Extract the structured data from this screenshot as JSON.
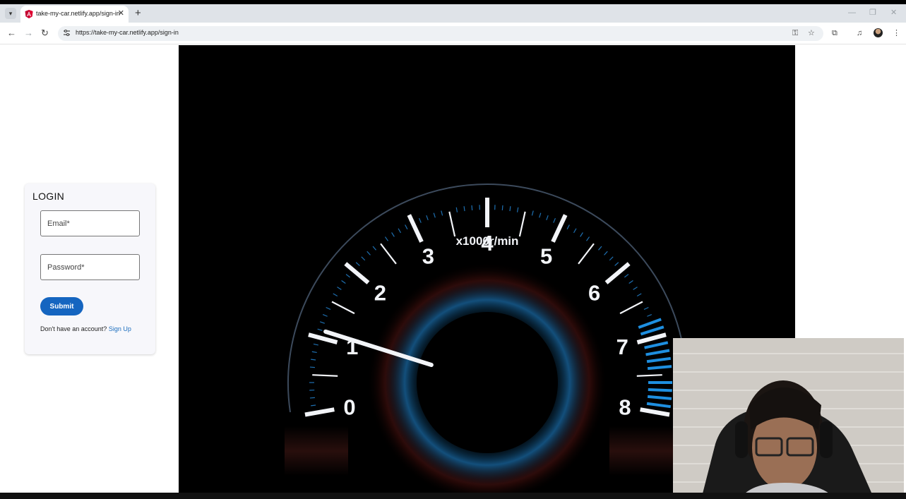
{
  "browser": {
    "tab": {
      "title": "take-my-car.netlify.app/sign-in",
      "close_label": "✕"
    },
    "new_tab_label": "+",
    "url": "https://take-my-car.netlify.app/sign-in",
    "window_controls": {
      "minimize": "—",
      "restore": "❐",
      "close": "✕"
    }
  },
  "login": {
    "title": "LOGIN",
    "email_placeholder": "Email*",
    "password_placeholder": "Password*",
    "submit_label": "Submit",
    "signup_prompt": "Don't have an account?",
    "signup_link": "Sign Up"
  },
  "hero": {
    "gauge_numbers": [
      "0",
      "1",
      "2",
      "3",
      "4",
      "5",
      "6",
      "7",
      "8"
    ],
    "gauge_unit": "x1000r/min",
    "needle_value": 1.1
  },
  "icons": {
    "tab_list": "chevron-down-icon",
    "favicon": "angular-logo-icon",
    "back": "arrow-left-icon",
    "forward": "arrow-right-icon",
    "reload": "reload-icon",
    "site_info": "tune-icon",
    "password": "key-icon",
    "bookmark": "star-icon",
    "extensions": "puzzle-icon",
    "media": "media-control-icon",
    "menu": "kebab-menu-icon"
  },
  "colors": {
    "accent": "#1565c0",
    "link": "#1e6fbf",
    "gauge_blue": "#1e8fe0",
    "gauge_white": "#f2f4f8"
  }
}
